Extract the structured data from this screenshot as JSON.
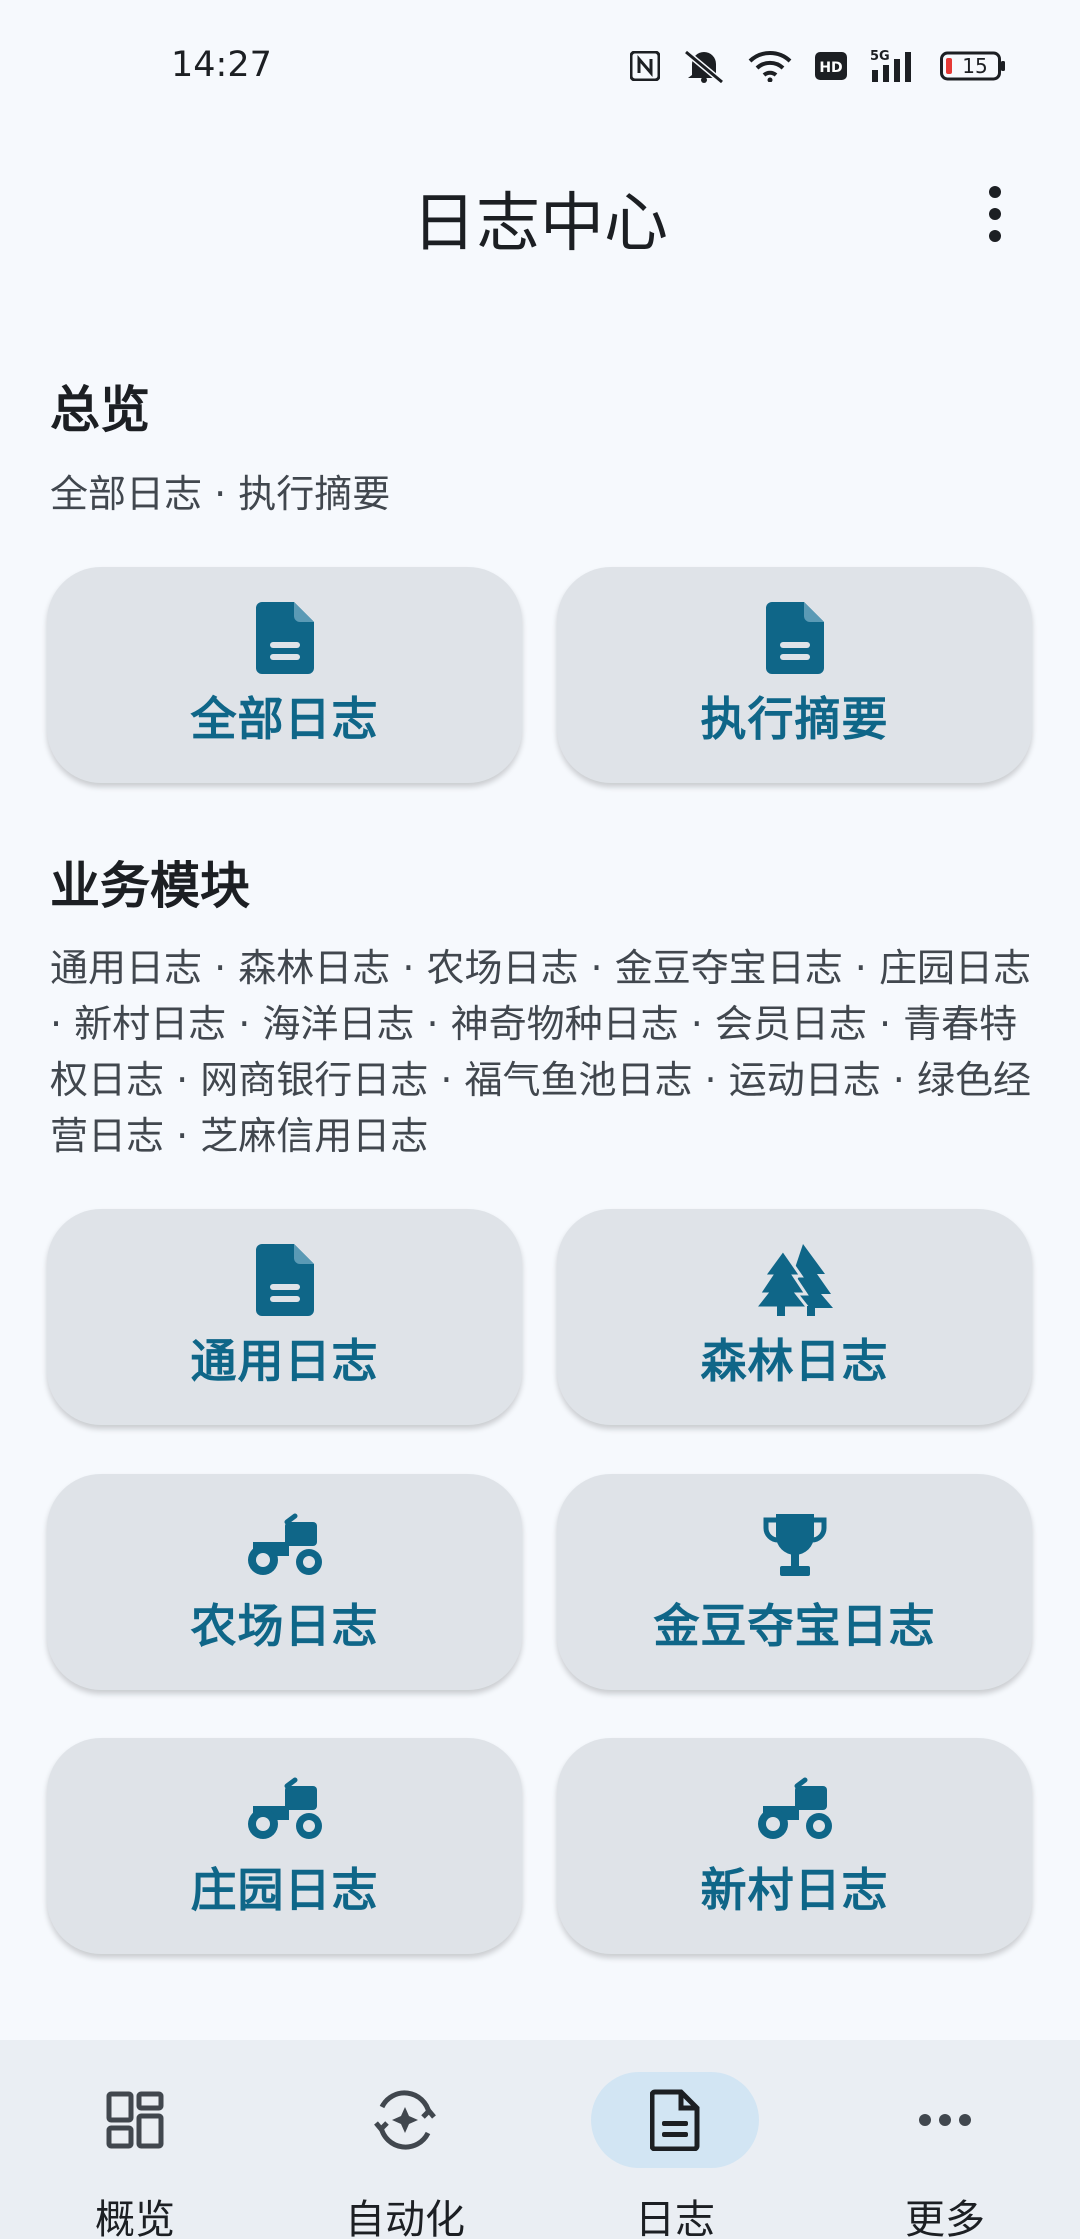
{
  "status_bar": {
    "time": "14:27",
    "battery": "15",
    "icons": [
      "nfc-icon",
      "mute-icon",
      "wifi-icon",
      "hd-icon",
      "signal-5g-icon",
      "battery-icon"
    ]
  },
  "header": {
    "title": "日志中心",
    "menu_icon": "more-vert-icon"
  },
  "overview": {
    "title": "总览",
    "description": "全部日志 · 执行摘要",
    "cards": [
      {
        "label": "全部日志",
        "icon": "document-icon"
      },
      {
        "label": "执行摘要",
        "icon": "document-icon"
      }
    ]
  },
  "modules": {
    "title": "业务模块",
    "description": "通用日志 · 森林日志 · 农场日志 · 金豆夺宝日志 · 庄园日志 · 新村日志 · 海洋日志 · 神奇物种日志 · 会员日志 · 青春特权日志 · 网商银行日志 · 福气鱼池日志 · 运动日志 · 绿色经营日志 · 芝麻信用日志",
    "cards": [
      {
        "label": "通用日志",
        "icon": "document-icon"
      },
      {
        "label": "森林日志",
        "icon": "forest-icon"
      },
      {
        "label": "农场日志",
        "icon": "tractor-icon"
      },
      {
        "label": "金豆夺宝日志",
        "icon": "trophy-icon"
      },
      {
        "label": "庄园日志",
        "icon": "tractor-icon"
      },
      {
        "label": "新村日志",
        "icon": "tractor-icon"
      }
    ]
  },
  "bottom_nav": {
    "items": [
      {
        "label": "概览",
        "icon": "dashboard-icon",
        "active": false
      },
      {
        "label": "自动化",
        "icon": "automation-icon",
        "active": false
      },
      {
        "label": "日志",
        "icon": "document-icon",
        "active": true
      },
      {
        "label": "更多",
        "icon": "more-horiz-icon",
        "active": false
      }
    ]
  },
  "colors": {
    "background": "#f6f9fd",
    "card": "#dfe3e8",
    "accent": "#0f6688",
    "nav_active_pill": "#d2e5f3",
    "battery_low": "#e53935"
  }
}
